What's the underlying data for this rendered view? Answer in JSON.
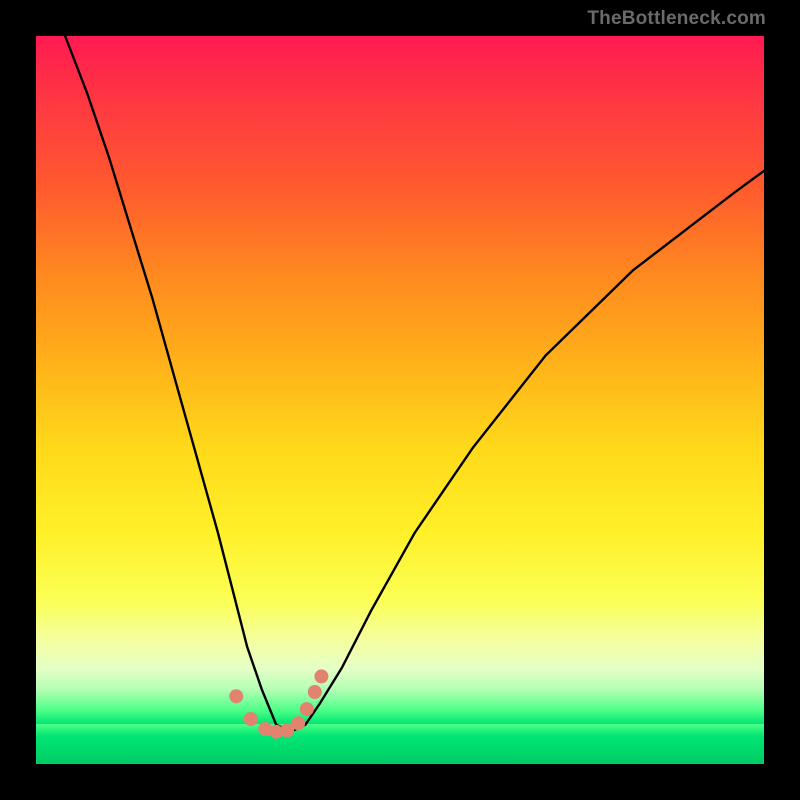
{
  "attribution": "TheBottleneck.com",
  "chart_data": {
    "type": "line",
    "title": "",
    "xlabel": "",
    "ylabel": "",
    "x_range": [
      0,
      100
    ],
    "y_range": [
      0,
      100
    ],
    "note": "Bottleneck-style curve. x is normalized horizontal position (0-100). y is bottleneck percentage (0 = no bottleneck, green band near bottom; 100 = full bottleneck, red at top). Curve reaches minimum near x≈33 then rises again.",
    "series": [
      {
        "name": "bottleneck-curve",
        "x": [
          4,
          7,
          10,
          13,
          16,
          19,
          22,
          25,
          27,
          29,
          31,
          33,
          35,
          37,
          39,
          42,
          46,
          52,
          60,
          70,
          82,
          96,
          100
        ],
        "y": [
          100,
          92,
          83,
          73,
          63,
          52,
          41,
          30,
          22,
          14,
          8,
          3,
          2,
          3,
          6,
          11,
          19,
          30,
          42,
          55,
          67,
          78,
          81
        ]
      }
    ],
    "markers": {
      "name": "highlight-points",
      "x": [
        27.5,
        29.5,
        31.5,
        33.0,
        34.5,
        36.0,
        37.2,
        38.3,
        39.2
      ],
      "y": [
        7.0,
        3.8,
        2.4,
        2.0,
        2.2,
        3.2,
        5.2,
        7.6,
        9.8
      ]
    },
    "gradient_stops": [
      {
        "pct": 0,
        "color": "#ff1a52"
      },
      {
        "pct": 22,
        "color": "#ff5a2e"
      },
      {
        "pct": 48,
        "color": "#ffb319"
      },
      {
        "pct": 72,
        "color": "#fff028"
      },
      {
        "pct": 92,
        "color": "#e4ffc7"
      },
      {
        "pct": 100,
        "color": "#00e673"
      }
    ]
  }
}
